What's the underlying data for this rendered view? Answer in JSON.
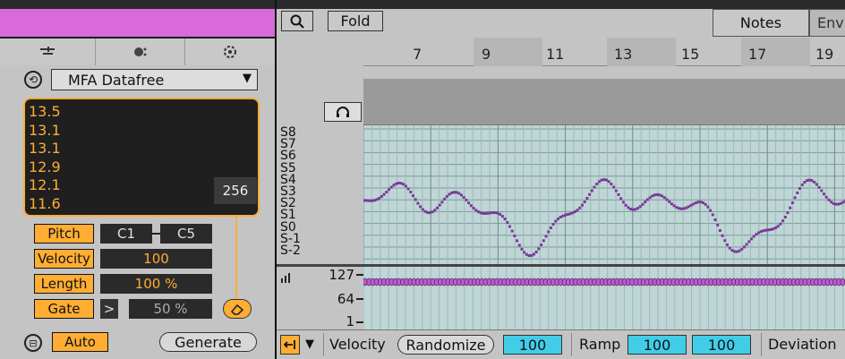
{
  "device": {
    "tabs": [
      "bars-icon",
      "dice-icon",
      "target-icon"
    ],
    "preset": "MFA Datafree",
    "values_text": [
      "13.5",
      "13.1",
      "13.1",
      "12.9",
      "12.1",
      "11.6"
    ],
    "count": "256",
    "pitch_label": "Pitch",
    "pitch_low": "C1",
    "pitch_high": "C5",
    "velocity_label": "Velocity",
    "velocity_value": "100",
    "length_label": "Length",
    "length_value": "100 %",
    "gate_label": "Gate",
    "gate_op": ">",
    "gate_value": "50 %",
    "auto_label": "Auto",
    "generate_label": "Generate"
  },
  "clip": {
    "fold_label": "Fold",
    "notes_tab": "Notes",
    "env_tab": "Env",
    "ruler": [
      "7",
      "9",
      "11",
      "13",
      "15",
      "17",
      "19"
    ],
    "scale_rows": [
      "S8",
      "S7",
      "S6",
      "S5",
      "S4",
      "S3",
      "S2",
      "S1",
      "S0",
      "S-1",
      "S-2"
    ],
    "velocity_axis": [
      "127",
      "64",
      "1"
    ],
    "velocity_label": "Velocity",
    "randomize_label": "Randomize",
    "velocity_value": "100",
    "ramp_label": "Ramp",
    "ramp_from": "100",
    "ramp_to": "100",
    "deviation_label": "Deviation"
  },
  "colors": {
    "accent": "#ffad33",
    "magenta_header": "#d96ad9",
    "note_color": "#7a3a9a",
    "velocity_marker": "#c05ad0",
    "cyan_field": "#41cde8"
  }
}
